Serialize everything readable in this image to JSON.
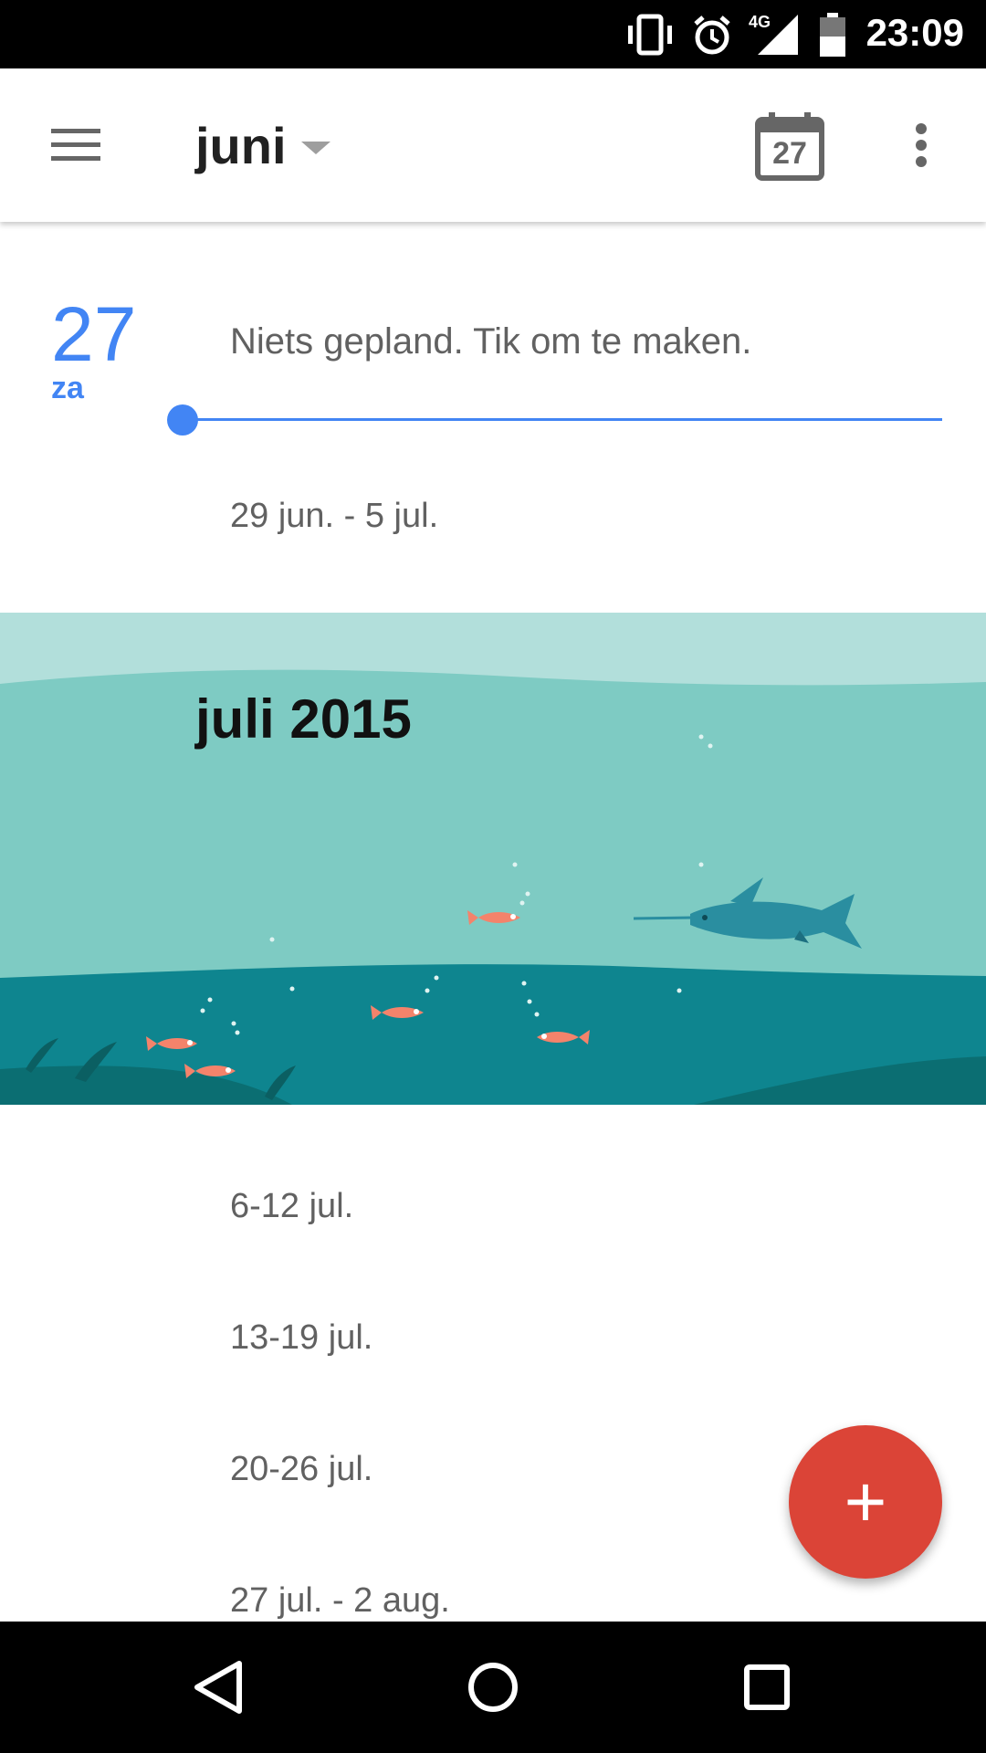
{
  "status_bar": {
    "time": "23:09",
    "network": "4G",
    "icons": [
      "vibrate-icon",
      "alarm-icon",
      "signal-icon",
      "battery-icon"
    ]
  },
  "app_bar": {
    "title": "juni",
    "today_date": "27",
    "icons": [
      "menu-icon",
      "dropdown-caret-icon",
      "calendar-today-icon",
      "overflow-menu-icon"
    ]
  },
  "agenda": {
    "day": {
      "number": "27",
      "weekday": "za",
      "message": "Niets gepland. Tik om te maken."
    },
    "week_before_banner": "29 jun. - 5 jul.",
    "banner": {
      "title": "juli 2015"
    },
    "weeks_after_banner": [
      "6-12 jul.",
      "13-19 jul.",
      "20-26 jul.",
      "27 jul. - 2 aug."
    ]
  },
  "fab": {
    "label": "+"
  },
  "nav_bar": {
    "icons": [
      "back-icon",
      "home-icon",
      "recents-icon"
    ]
  },
  "colors": {
    "accent": "#4285f4",
    "fab": "#db4437",
    "sea_light": "#7ecbc3",
    "sea_dark": "#0e858f",
    "sky": "#b2dfdb"
  }
}
